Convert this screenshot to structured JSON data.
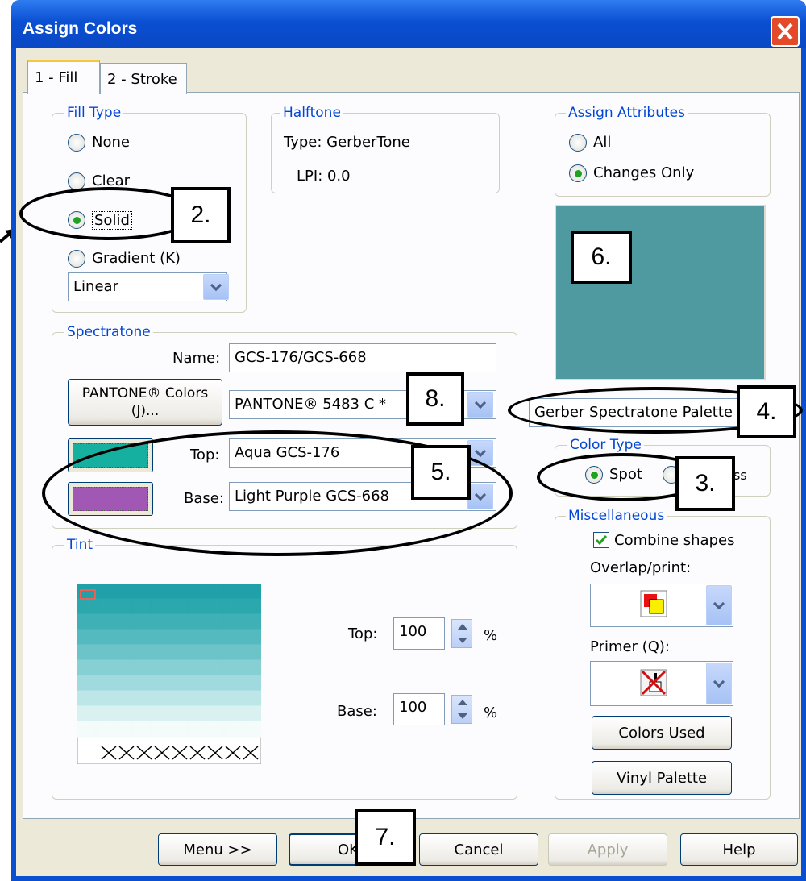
{
  "window": {
    "title": "Assign Colors"
  },
  "tabs": [
    {
      "label": "1 - Fill",
      "active": true
    },
    {
      "label": "2 - Stroke",
      "active": false
    }
  ],
  "fill_type": {
    "label": "Fill Type",
    "options": [
      {
        "label": "None",
        "selected": false
      },
      {
        "label": "Clear",
        "selected": false
      },
      {
        "label": "Solid",
        "selected": true
      },
      {
        "label": "Gradient (K)",
        "selected": false
      }
    ],
    "gradient_select": "Linear"
  },
  "halftone": {
    "label": "Halftone",
    "type": "Type: GerberTone",
    "lpi": "LPI: 0.0"
  },
  "assign_attributes": {
    "label": "Assign Attributes",
    "options": [
      {
        "label": "All",
        "selected": false
      },
      {
        "label": "Changes Only",
        "selected": true
      }
    ]
  },
  "preview_color": "#4e9aa0",
  "spectratone": {
    "label": "Spectratone",
    "name_label": "Name:",
    "name_value": "GCS-176/GCS-668",
    "pantone_button": "PANTONE® Colors (J)...",
    "pantone_select": "PANTONE® 5483 C *",
    "top_label": "Top:",
    "top_value": "Aqua GCS-176",
    "top_color": "#15b0a0",
    "base_label": "Base:",
    "base_value": "Light Purple GCS-668",
    "base_color": "#a058b4"
  },
  "palette_select": "Gerber Spectratone Palette",
  "color_type": {
    "label": "Color Type",
    "options": [
      {
        "label": "Spot",
        "selected": true
      },
      {
        "label": "ss",
        "selected": false
      }
    ]
  },
  "tint": {
    "label": "Tint",
    "top_label": "Top:",
    "top_value": "100",
    "base_label": "Base:",
    "base_value": "100",
    "percent": "%",
    "grid_colors": [
      "#20a0a8",
      "#2ba7ae",
      "#3eb0b6",
      "#55bac0",
      "#6cc4c9",
      "#86cfd3",
      "#a0dade",
      "#bde6e8",
      "#daf1f2",
      "#f3fbfb"
    ]
  },
  "miscellaneous": {
    "label": "Miscellaneous",
    "combine_shapes": "Combine shapes",
    "combine_checked": true,
    "overlap_label": "Overlap/print:",
    "primer_label": "Primer (Q):",
    "colors_used": "Colors Used",
    "vinyl_palette": "Vinyl Palette"
  },
  "footer": {
    "menu": "Menu >>",
    "ok": "OK",
    "cancel": "Cancel",
    "apply": "Apply",
    "help": "Help"
  },
  "callouts": [
    "2.",
    "3.",
    "4.",
    "5.",
    "6.",
    "7.",
    "8."
  ]
}
